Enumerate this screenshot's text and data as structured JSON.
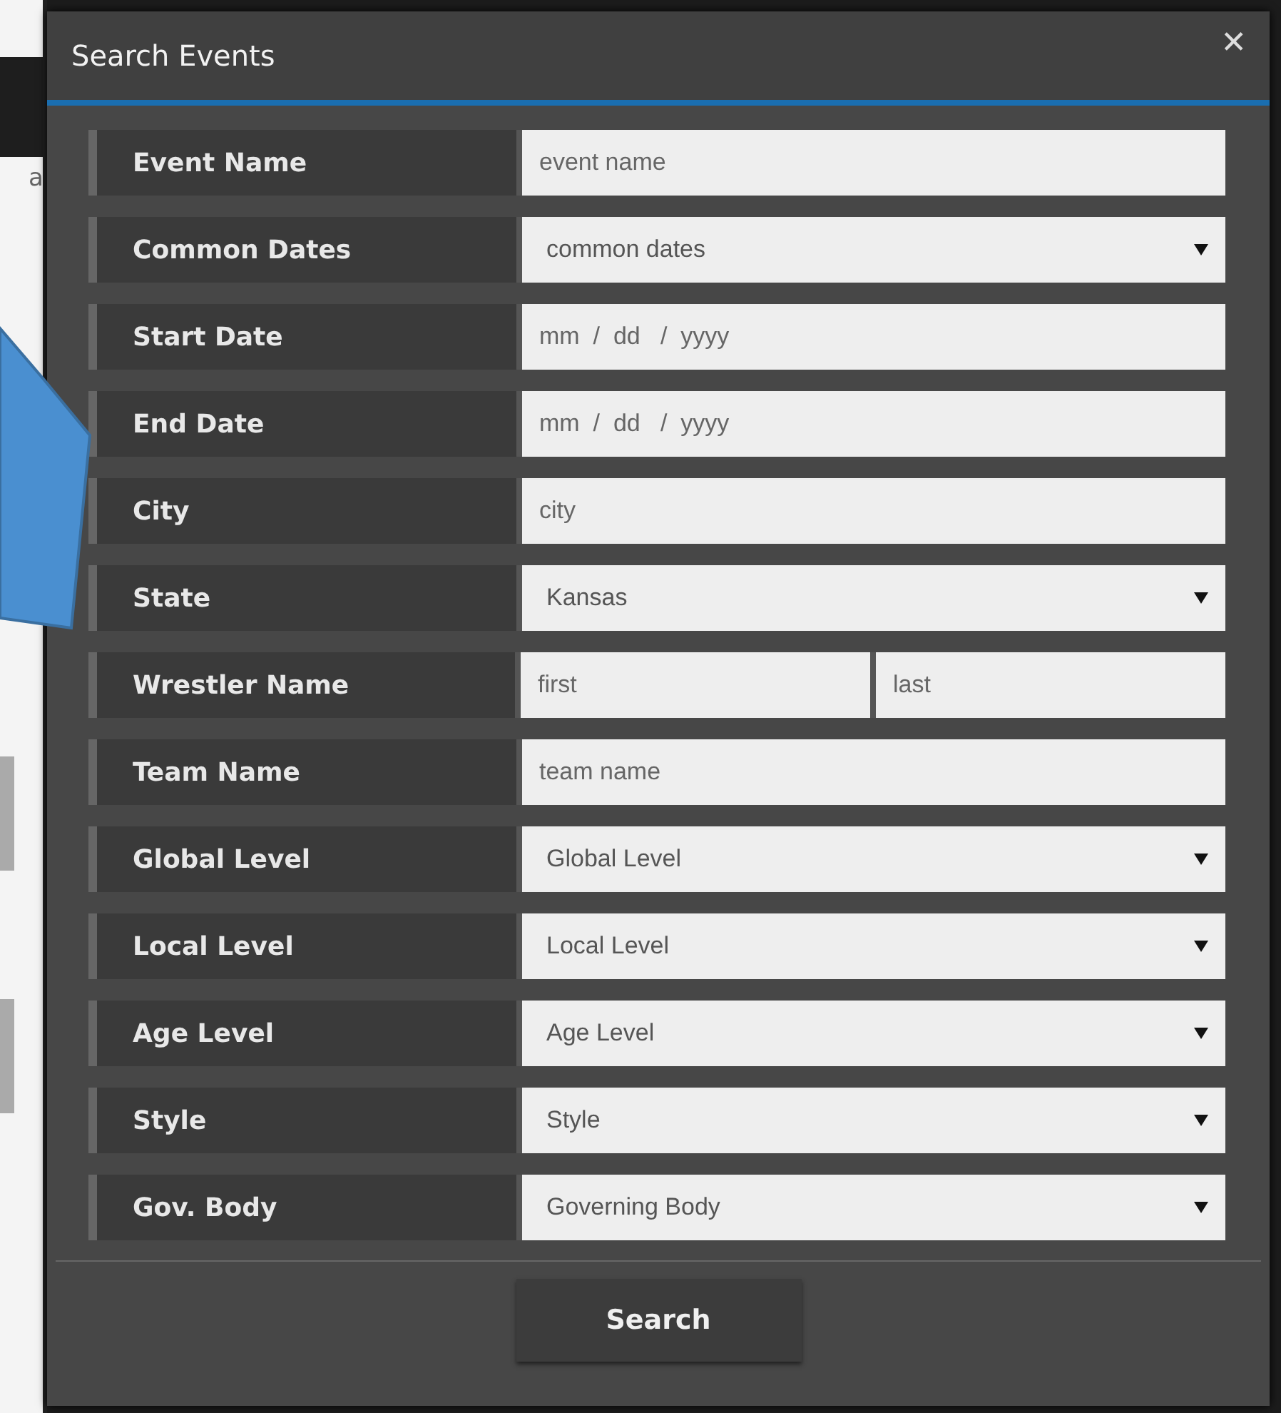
{
  "background": {
    "fragment": "a"
  },
  "dialog": {
    "title": "Search Events",
    "close": "✕",
    "fields": [
      {
        "label": "Event Name",
        "kind": "text",
        "placeholder": "event name"
      },
      {
        "label": "Common Dates",
        "kind": "select",
        "value": "common dates"
      },
      {
        "label": "Start Date",
        "kind": "date",
        "placeholder": "mm  /  dd   /  yyyy"
      },
      {
        "label": "End Date",
        "kind": "date",
        "placeholder": "mm  /  dd   /  yyyy"
      },
      {
        "label": "City",
        "kind": "text",
        "placeholder": "city"
      },
      {
        "label": "State",
        "kind": "select",
        "value": "Kansas"
      },
      {
        "label": "Wrestler Name",
        "kind": "pair",
        "placeholders": [
          "first",
          "last"
        ]
      },
      {
        "label": "Team Name",
        "kind": "text",
        "placeholder": "team name"
      },
      {
        "label": "Global Level",
        "kind": "select",
        "value": "Global Level"
      },
      {
        "label": "Local Level",
        "kind": "select",
        "value": "Local Level"
      },
      {
        "label": "Age Level",
        "kind": "select",
        "value": "Age Level"
      },
      {
        "label": "Style",
        "kind": "select",
        "value": "Style"
      },
      {
        "label": "Gov. Body",
        "kind": "select",
        "value": "Governing Body"
      }
    ],
    "button": "Search"
  }
}
